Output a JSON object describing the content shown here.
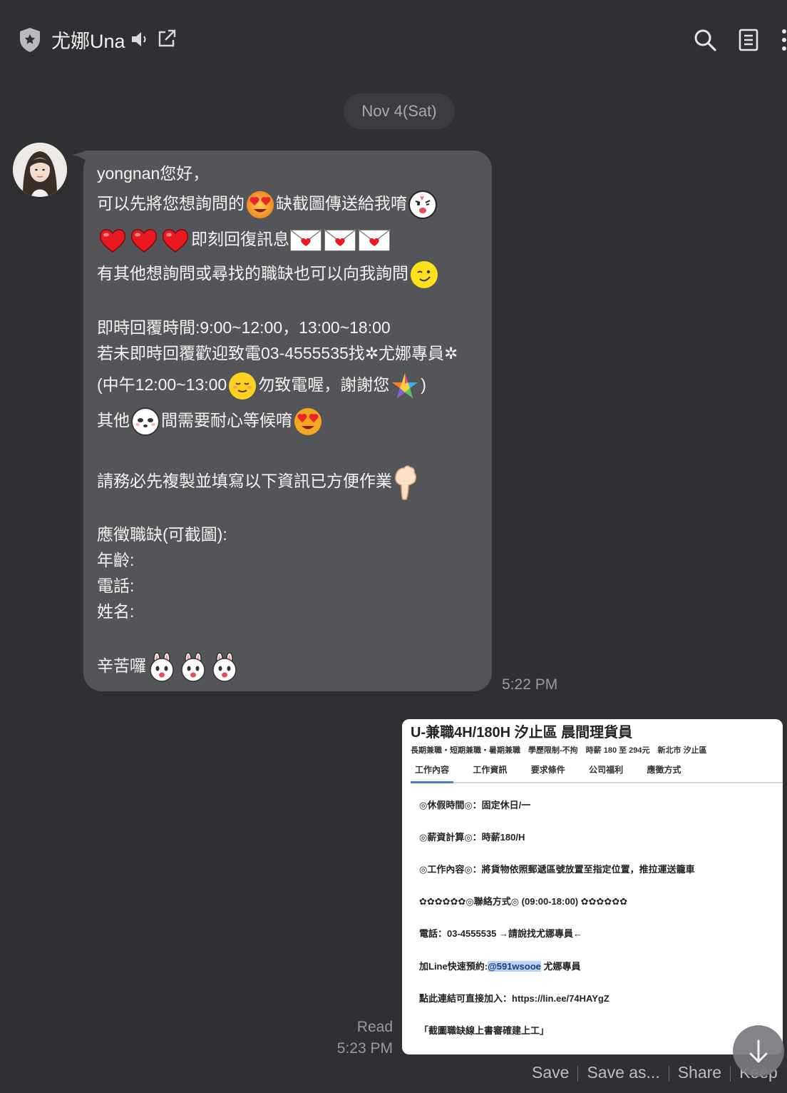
{
  "header": {
    "title": "尤娜Una",
    "icons": [
      "shield-icon",
      "speaker-icon",
      "external-link-icon",
      "search-icon",
      "notes-icon",
      "more-icon"
    ]
  },
  "chat": {
    "date_chip": "Nov 4(Sat)",
    "incoming": {
      "lines": {
        "l1": "yongnan您好，",
        "l2a": "可以先將您想詢問的",
        "l2b": "缺截圖傳送給我唷",
        "l3": "即刻回復訊息",
        "l4": "有其他想詢問或尋找的職缺也可以向我詢問",
        "l5": "即時回覆時間:9:00~12:00，13:00~18:00",
        "l6": "若未即時回覆歡迎致電03-4555535找✲尤娜專員✲",
        "l7a": "(中午12:00~13:00",
        "l7b": "勿致電喔，謝謝您",
        "l7c": ")",
        "l8a": "其他",
        "l8b": "間需要耐心等候唷",
        "l9": "請務必先複製並填寫以下資訊已方便作業",
        "l10": "應徵職缺(可截圖):",
        "l11": "年齡:",
        "l12": "電話:",
        "l13": "姓名:",
        "l14": "辛苦囉"
      },
      "time": "5:22 PM"
    },
    "outgoing": {
      "read_label": "Read",
      "time": "5:23 PM",
      "image": {
        "title": "U-兼職4H/180H 汐止區 晨間理貨員",
        "tags": "長期兼職・短期兼職・暑期兼職　學歷限制-不拘　時薪 180 至 294元　新北市 汐止區",
        "tabs": [
          "工作內容",
          "工作資訊",
          "要求條件",
          "公司福利",
          "應徵方式"
        ],
        "lines": [
          "◎休假時間◎：固定休日/一",
          "◎薪資計算◎：時薪180/H",
          "◎工作內容◎：將貨物依照郵遞區號放置至指定位置，推拉運送籠車",
          "✿✿✿✿✿✿◎聯絡方式◎ (09:00-18:00) ✿✿✿✿✿✿",
          "電話：03-4555535 →請說找尤娜專員←"
        ],
        "line_id_prefix": "加Line快速預約:",
        "line_id": "@591wsooe",
        "line_id_suffix": " 尤娜專員",
        "link_line": "點此連結可直接加入：https://lin.ee/74HAYgZ",
        "note_line": "「截圖職缺線上書審確建上工」"
      }
    }
  },
  "actions": {
    "save": "Save",
    "save_as": "Save as...",
    "share": "Share",
    "keep": "Keep"
  },
  "colors": {
    "background": "#2f3033",
    "bubble_in": "#545558",
    "date_chip": "#3b3c40",
    "highlight": "#b8d4f5"
  }
}
